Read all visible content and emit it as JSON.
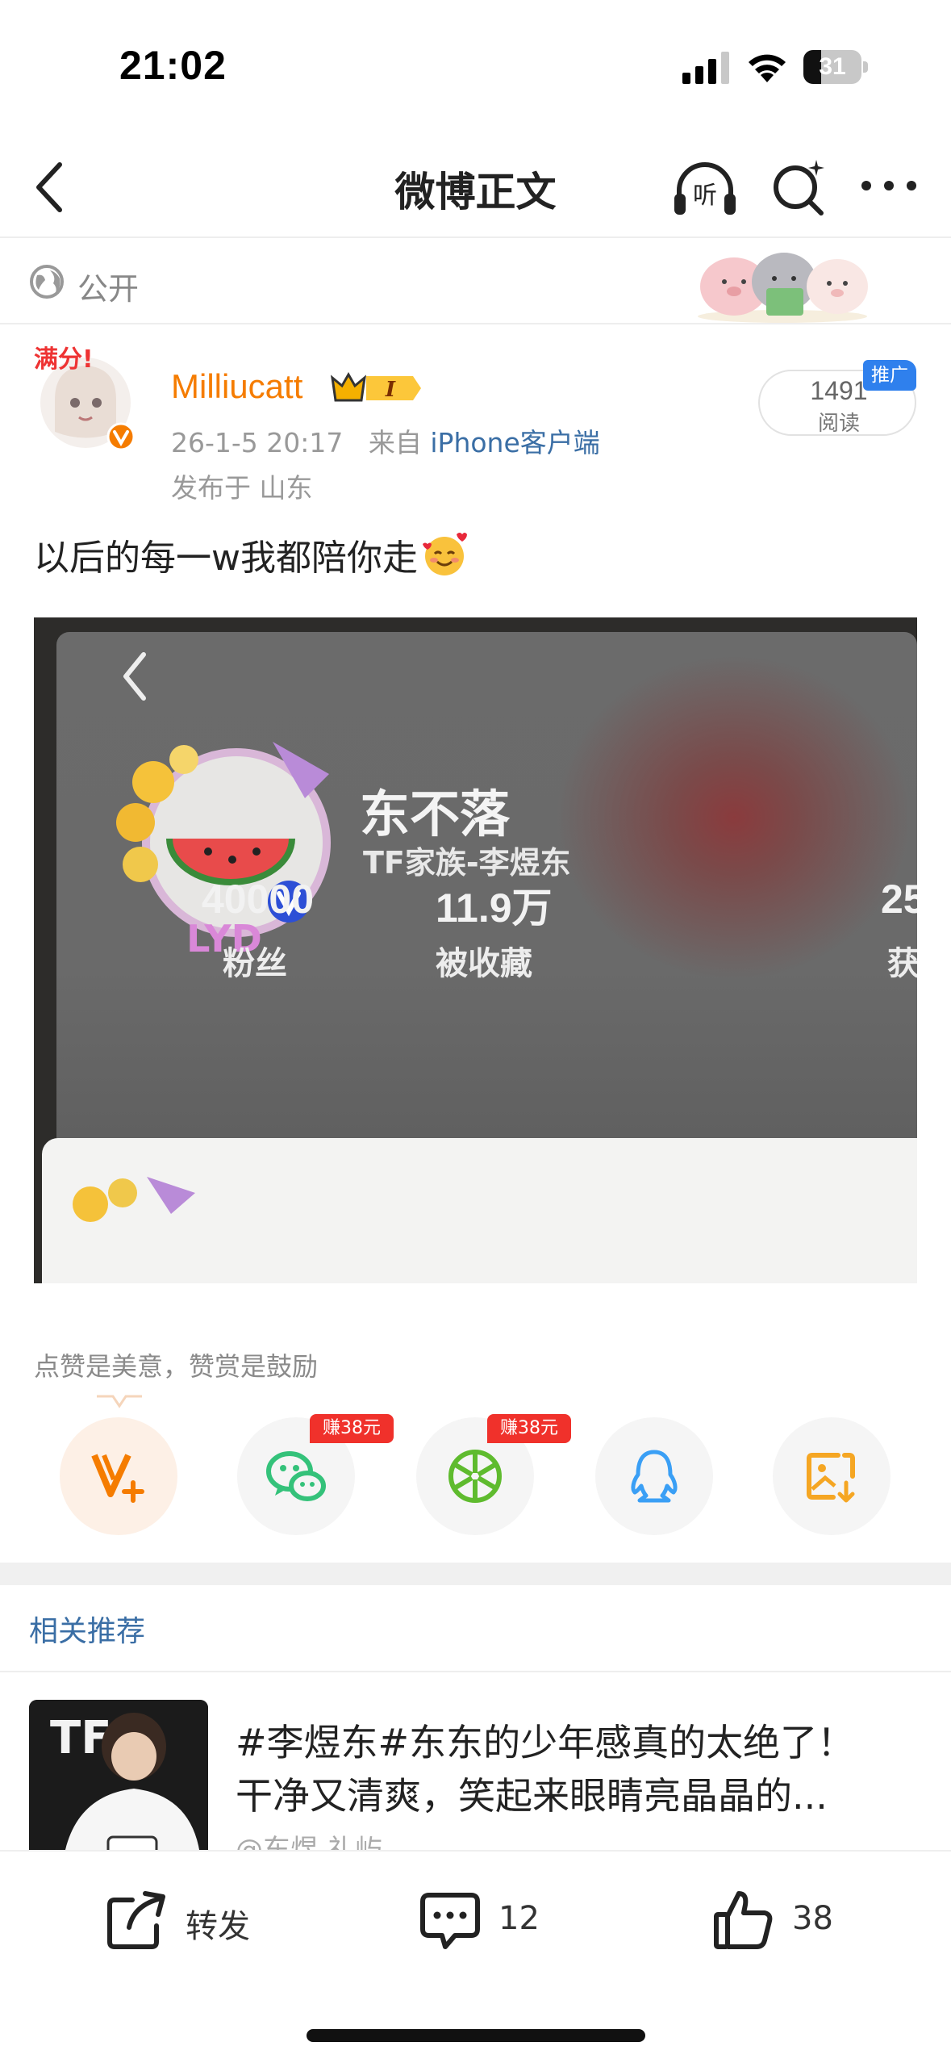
{
  "status_bar": {
    "time": "21:02",
    "battery": "31",
    "battery_level": 0.31
  },
  "nav": {
    "title": "微博正文",
    "listen_label": "听"
  },
  "visibility": {
    "label": "公开"
  },
  "author": {
    "name": "Milliucatt",
    "vip_level": "I",
    "avatar_tag": "满分!",
    "verified": true
  },
  "post": {
    "date": "26-1-5 20:17",
    "source_prefix": "来自",
    "source": "iPhone客户端",
    "location": "发布于 山东",
    "text": "以后的每一w我都陪你走",
    "reads": "1491",
    "reads_label": "阅读",
    "promo_tag": "推广"
  },
  "photo": {
    "profile_name": "东不落",
    "profile_subtitle": "TF家族-李煜东",
    "stats": [
      {
        "value": "40000",
        "label": "粉丝"
      },
      {
        "value": "11.9万",
        "label": "被收藏"
      },
      {
        "value": "25",
        "label": "获"
      }
    ]
  },
  "encourage_text": "点赞是美意，赞赏是鼓励",
  "share": {
    "items": [
      {
        "name": "weibo",
        "badge": ""
      },
      {
        "name": "wechat",
        "badge": "赚38元"
      },
      {
        "name": "moments",
        "badge": "赚38元"
      },
      {
        "name": "qq",
        "badge": ""
      },
      {
        "name": "save-image",
        "badge": ""
      }
    ]
  },
  "related": {
    "title": "相关推荐",
    "item": {
      "line1": "#李煜东#东东的少年感真的太绝了！",
      "line2": "干净又清爽，笑起来眼睛亮晶晶的...",
      "author": "@东煜-礼屿"
    }
  },
  "toolbar": {
    "repost": "转发",
    "comments": "12",
    "likes": "38"
  },
  "colors": {
    "accent": "#f57c00",
    "link": "#3a6ea5",
    "badge_red": "#f0312b",
    "promo_blue": "#2f80ed"
  }
}
